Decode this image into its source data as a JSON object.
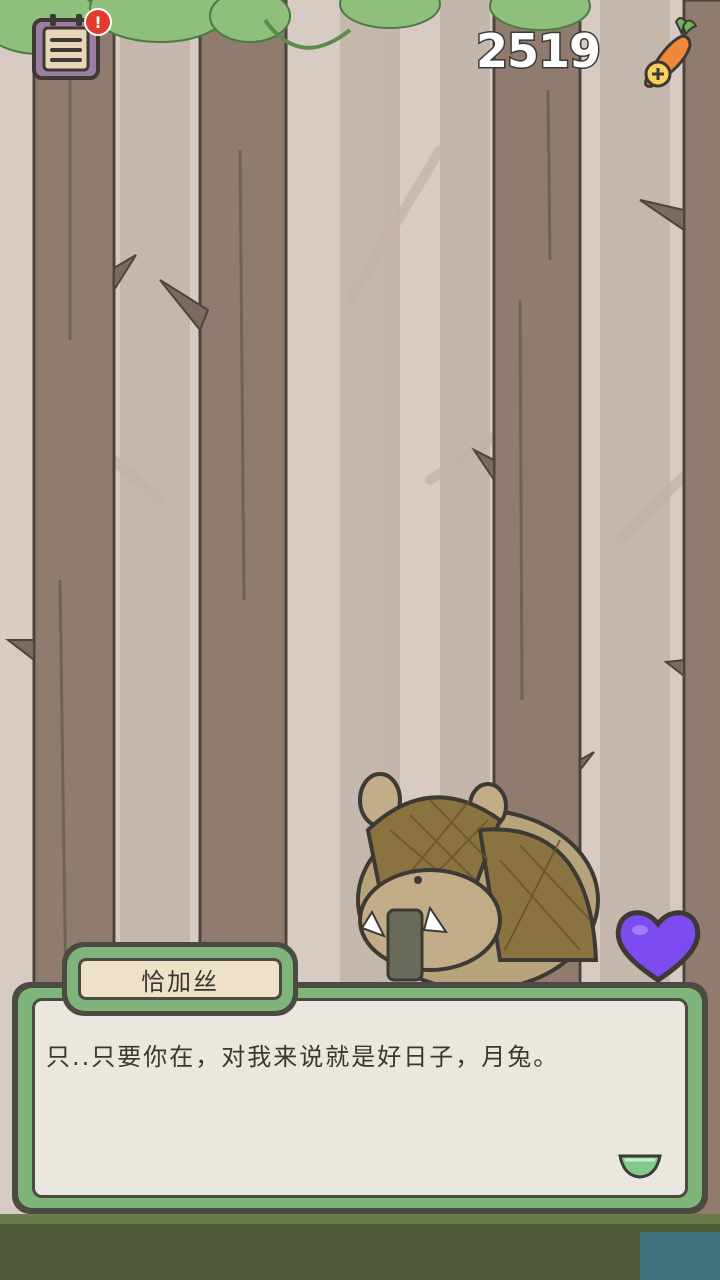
{
  "hud": {
    "menu_icon": "journal-menu-icon",
    "notification_badge": "!",
    "carrot_count": "2519",
    "carrot_icon": "carrot-add-icon"
  },
  "dialog": {
    "speaker_name": "恰加丝",
    "line": "只..只要你在，对我来说就是好日子，月兔。",
    "continue_icon": "continue-arrow-icon"
  },
  "affection": {
    "icon": "heart-icon",
    "color": "#7d4cf0"
  },
  "colors": {
    "frame_green": "#7fb47a",
    "frame_dark": "#4b4a43",
    "name_plate": "#efe1c8",
    "sky": "#cbbcb1"
  }
}
